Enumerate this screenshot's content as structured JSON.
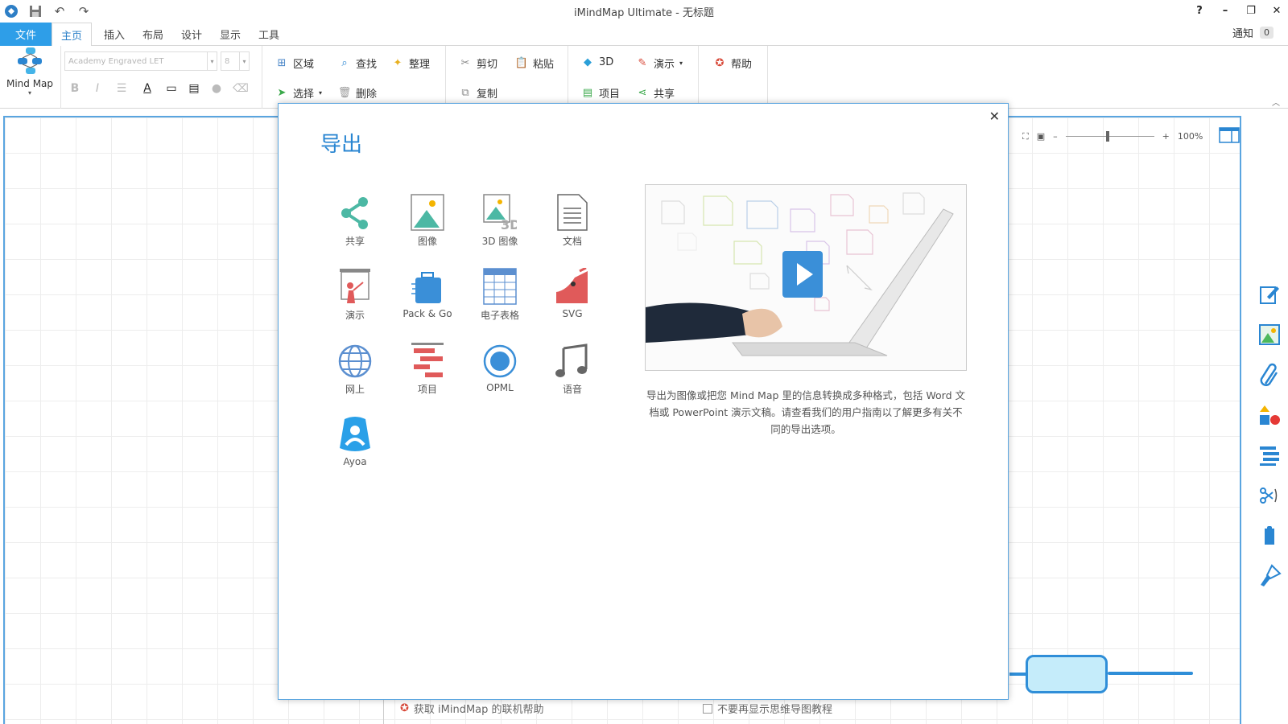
{
  "window": {
    "title": "iMindMap Ultimate - 无标题"
  },
  "tabs": {
    "file": "文件",
    "home": "主页",
    "insert": "插入",
    "layout": "布局",
    "design": "设计",
    "view": "显示",
    "tools": "工具"
  },
  "notifications": {
    "label": "通知",
    "count": "0"
  },
  "ribbon": {
    "mindmap_label": "Mind Map",
    "font_name": "Academy Engraved LET",
    "font_size": "8",
    "region": "区域",
    "find": "查找",
    "tidy": "整理",
    "select": "选择",
    "delete": "删除",
    "cut": "剪切",
    "paste": "粘贴",
    "copy": "复制",
    "three_d": "3D",
    "present": "演示",
    "project": "项目",
    "share": "共享",
    "help": "帮助"
  },
  "zoom": {
    "level": "100%"
  },
  "dialog": {
    "title": "导出",
    "items": [
      {
        "label": "共享"
      },
      {
        "label": "图像"
      },
      {
        "label": "3D 图像"
      },
      {
        "label": "文档"
      },
      {
        "label": "演示"
      },
      {
        "label": "Pack & Go"
      },
      {
        "label": "电子表格"
      },
      {
        "label": "SVG"
      },
      {
        "label": "网上"
      },
      {
        "label": "项目"
      },
      {
        "label": "OPML"
      },
      {
        "label": "语音"
      },
      {
        "label": "Ayoa"
      }
    ],
    "description": "导出为图像或把您 Mind Map 里的信息转换成多种格式，包括 Word 文档或 PowerPoint 演示文稿。请查看我们的用户指南以了解更多有关不同的导出选项。"
  },
  "bottom": {
    "online_help": "获取 iMindMap 的联机帮助",
    "dont_show": "不要再显示思维导图教程"
  }
}
